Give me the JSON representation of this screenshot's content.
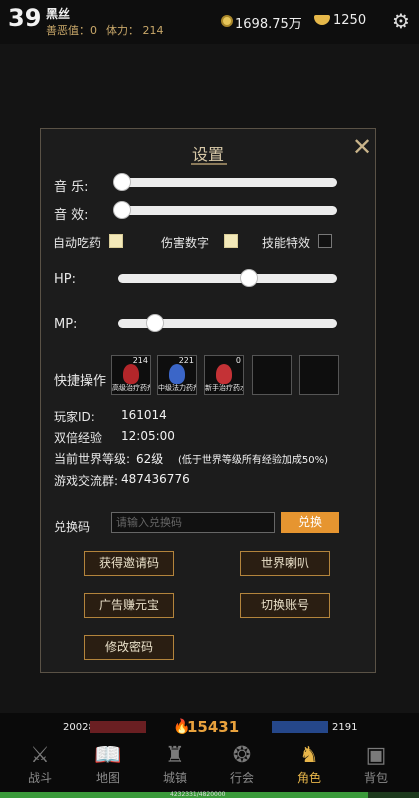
{
  "player": {
    "level": "39",
    "name": "黑丝",
    "karma": "善恶值：0",
    "stamina": "体力： 214",
    "coins": "1698.75万",
    "ingots": "1250"
  },
  "settings": {
    "title": "设置",
    "music_label": "音 乐:",
    "sfx_label": "音 效:",
    "auto_eat_label": "自动吃药",
    "damage_label": "伤害数字",
    "skill_fx_label": "技能特效",
    "hp_label": "HP:",
    "mp_label": "MP:",
    "hp_threshold": 0.6,
    "mp_threshold": 0.17,
    "quick_label": "快捷操作",
    "slots": [
      {
        "count": "214",
        "name": "高级治疗药剂",
        "color": "#b3262a"
      },
      {
        "count": "221",
        "name": "中级法力药剂",
        "color": "#3b66c8"
      },
      {
        "count": "0",
        "name": "新手治疗药水",
        "color": "#c43236"
      }
    ],
    "player_id_label": "玩家ID:",
    "player_id": "161014",
    "double_xp_label": "双倍经验",
    "double_xp": "12:05:00",
    "world_level_label": "当前世界等级:",
    "world_level": "62级",
    "world_level_note": "(低于世界等级所有经验加成50%)",
    "group_label": "游戏交流群:",
    "group": "487436776",
    "redeem_label": "兑换码",
    "redeem_placeholder": "请输入兑换码",
    "redeem_button": "兑换",
    "btn_invite": "获得邀请码",
    "btn_world_horn": "世界喇叭",
    "btn_ad": "广告赚元宝",
    "btn_switch": "切换账号",
    "btn_password": "修改密码"
  },
  "hud": {
    "hp": "20028",
    "power": "15431",
    "mp": "2191",
    "xp_text": "4232331/4820000",
    "xp_ratio": 0.878
  },
  "nav": [
    {
      "label": "战斗",
      "icon": "crossed-swords-icon",
      "glyph": "⚔"
    },
    {
      "label": "地图",
      "icon": "map-book-icon",
      "glyph": "📖"
    },
    {
      "label": "城镇",
      "icon": "town-icon",
      "glyph": "♜"
    },
    {
      "label": "行会",
      "icon": "guild-icon",
      "glyph": "❂"
    },
    {
      "label": "角色",
      "icon": "character-icon",
      "glyph": "♞"
    },
    {
      "label": "背包",
      "icon": "backpack-icon",
      "glyph": "▣"
    }
  ]
}
